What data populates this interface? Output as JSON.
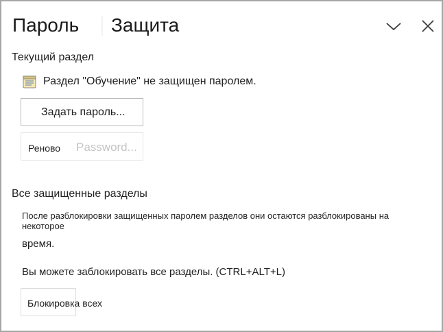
{
  "header": {
    "tab_password": "Пароль",
    "tab_protect": "Защита",
    "collapse_icon": "chevron-down-icon",
    "close_icon": "close-icon"
  },
  "current_section": {
    "title": "Текущий раздел",
    "status_icon": "section-page-icon",
    "status_text": "Раздел \"Обучение\" не защищен паролем.",
    "set_password_label": "Задать пароль...",
    "reset_label": "Реново",
    "reset_password_word": "Password..."
  },
  "all_sections": {
    "title": "Все защищенные разделы",
    "info_line1": "После разблокировки защищенных паролем разделов они остаются разблокированы на некоторое",
    "info_line2": "время.",
    "lock_hint": "Вы можете заблокировать все разделы. (CTRL+ALT+L)",
    "lock_all_label": "Блокировка всех"
  },
  "colors": {
    "border": "#a6a6a6",
    "background": "#ffffff",
    "disabled_text": "#c4c4c4"
  }
}
